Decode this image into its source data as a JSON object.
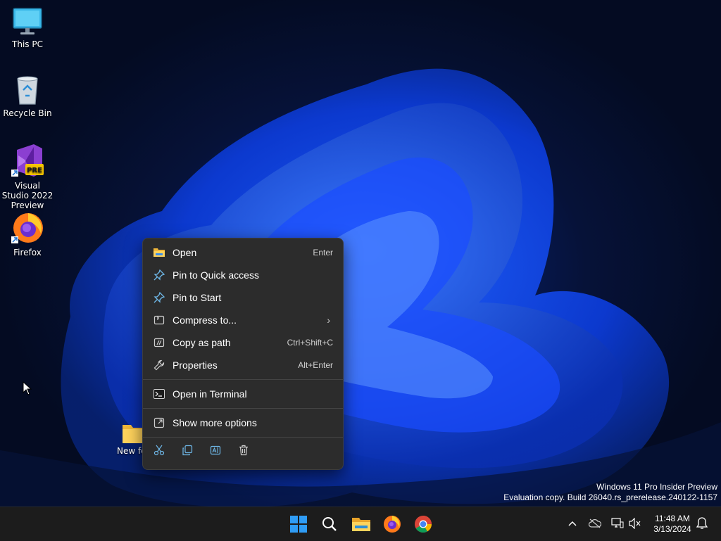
{
  "desktop": {
    "icons": [
      {
        "label": "This PC",
        "icon": "monitor-icon"
      },
      {
        "label": "Recycle Bin",
        "icon": "recycle-bin-icon"
      },
      {
        "label": "Visual Studio 2022 Preview",
        "icon": "visual-studio-icon",
        "badge": "PRE"
      },
      {
        "label": "Firefox",
        "icon": "firefox-icon"
      }
    ],
    "folder_label": "New fo"
  },
  "context_menu": {
    "items": [
      {
        "label": "Open",
        "shortcut": "Enter",
        "icon": "folder-open-icon"
      },
      {
        "label": "Pin to Quick access",
        "shortcut": "",
        "icon": "pin-icon"
      },
      {
        "label": "Pin to Start",
        "shortcut": "",
        "icon": "pin-icon"
      },
      {
        "label": "Compress to...",
        "shortcut": "",
        "icon": "zip-icon",
        "submenu": true
      },
      {
        "label": "Copy as path",
        "shortcut": "Ctrl+Shift+C",
        "icon": "copy-path-icon"
      },
      {
        "label": "Properties",
        "shortcut": "Alt+Enter",
        "icon": "wrench-icon"
      },
      {
        "label": "Open in Terminal",
        "shortcut": "",
        "icon": "terminal-icon"
      },
      {
        "label": "Show more options",
        "shortcut": "",
        "icon": "external-icon"
      }
    ],
    "actions": [
      "cut-icon",
      "copy-icon",
      "rename-icon",
      "delete-icon"
    ]
  },
  "watermark": {
    "line1": "Windows 11 Pro Insider Preview",
    "line2": "Evaluation copy. Build 26040.rs_prerelease.240122-1157"
  },
  "taskbar": {
    "apps": [
      "start-icon",
      "search-icon",
      "file-explorer-icon",
      "firefox-icon",
      "chrome-icon"
    ],
    "tray": [
      "chevron-up-icon",
      "onedrive-icon",
      "network-icon",
      "volume-muted-icon"
    ],
    "time": "11:48 AM",
    "date": "3/13/2024"
  },
  "colors": {
    "menu_bg": "#2c2c2c",
    "taskbar_bg": "#1c1c1c",
    "accent": "#0078d4"
  }
}
